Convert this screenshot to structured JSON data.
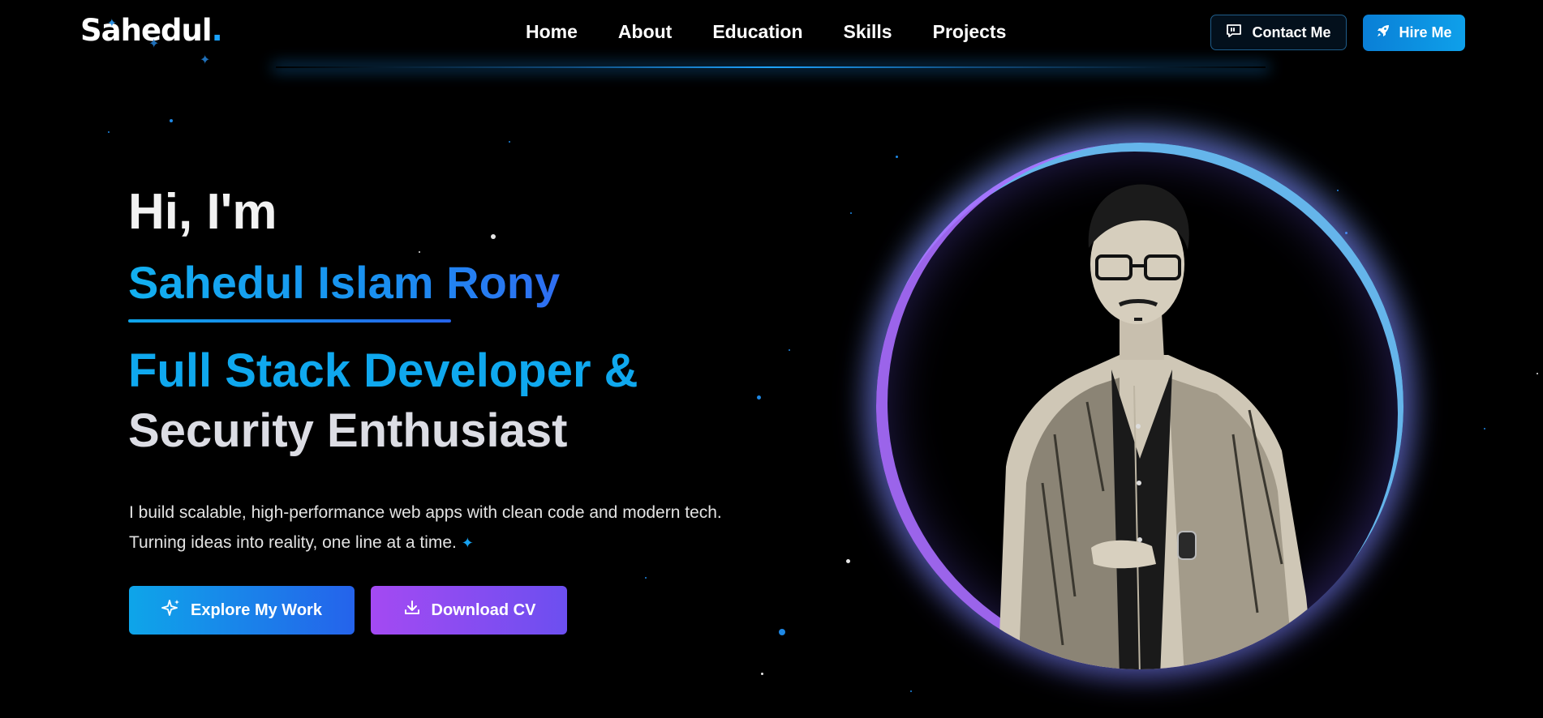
{
  "brand": {
    "logo_text": "Sahedul",
    "logo_dot": "."
  },
  "nav": {
    "links": [
      "Home",
      "About",
      "Education",
      "Skills",
      "Projects"
    ],
    "contact_label": "Contact Me",
    "hire_label": "Hire Me"
  },
  "hero": {
    "greeting": "Hi, I'm",
    "name": "Sahedul Islam Rony",
    "role_line1": "Full Stack Developer &",
    "role_line2": "Security Enthusiast",
    "desc_line1": "I build scalable, high-performance web apps with clean code and modern tech.",
    "desc_line2": "Turning ideas into reality, one line at a time.",
    "explore_label": "Explore My Work",
    "cv_label": "Download CV"
  },
  "colors": {
    "accent_blue": "#0ea5e9",
    "accent_purple": "#a44af2",
    "background": "#000000"
  },
  "icons": {
    "contact": "chat-quote-icon",
    "hire": "rocket-icon",
    "explore": "sparkles-icon",
    "cv": "download-icon",
    "desc_spark": "sparkle-icon"
  }
}
